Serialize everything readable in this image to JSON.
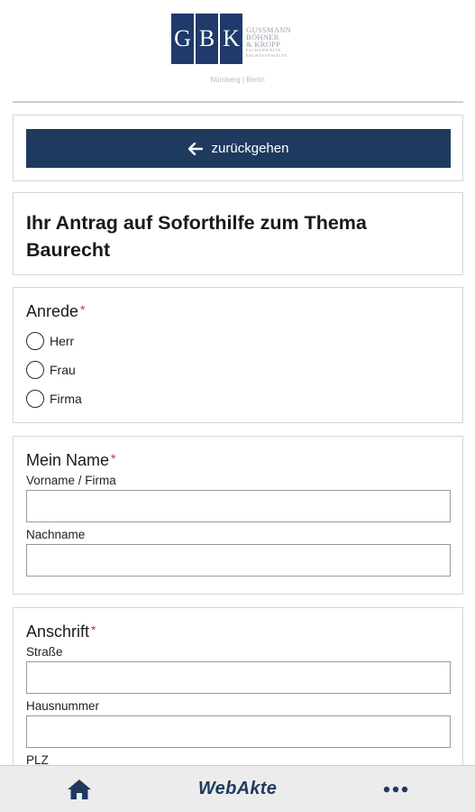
{
  "header": {
    "logo_letters": [
      "G",
      "B",
      "K"
    ],
    "logo_lines": [
      "GUSSMANN",
      "BÖHNER",
      "& KROPP"
    ],
    "logo_small_lines": [
      "FACHANWÄLTE",
      "RECHTSANWÄLTE"
    ],
    "cities": "Nürnberg | Berlin"
  },
  "back_button": {
    "label": "zurückgehen",
    "icon": "arrow-left-icon"
  },
  "title": "Ihr Antrag auf Soforthilfe zum Thema Baurecht",
  "anrede": {
    "label": "Anrede",
    "required_mark": "*",
    "options": [
      "Herr",
      "Frau",
      "Firma"
    ]
  },
  "name_section": {
    "label": "Mein Name",
    "required_mark": "*",
    "first_label": "Vorname / Firma",
    "last_label": "Nachname"
  },
  "address_section": {
    "label": "Anschrift",
    "required_mark": "*",
    "street_label": "Straße",
    "number_label": "Hausnummer",
    "zip_label": "PLZ"
  },
  "bottom_nav": {
    "home_icon": "home-icon",
    "brand": "WebAkte",
    "more_icon": "more-dots-icon"
  },
  "colors": {
    "primary": "#1f3a5f",
    "logo": "#1f3a6b",
    "required": "#d32f2f"
  }
}
